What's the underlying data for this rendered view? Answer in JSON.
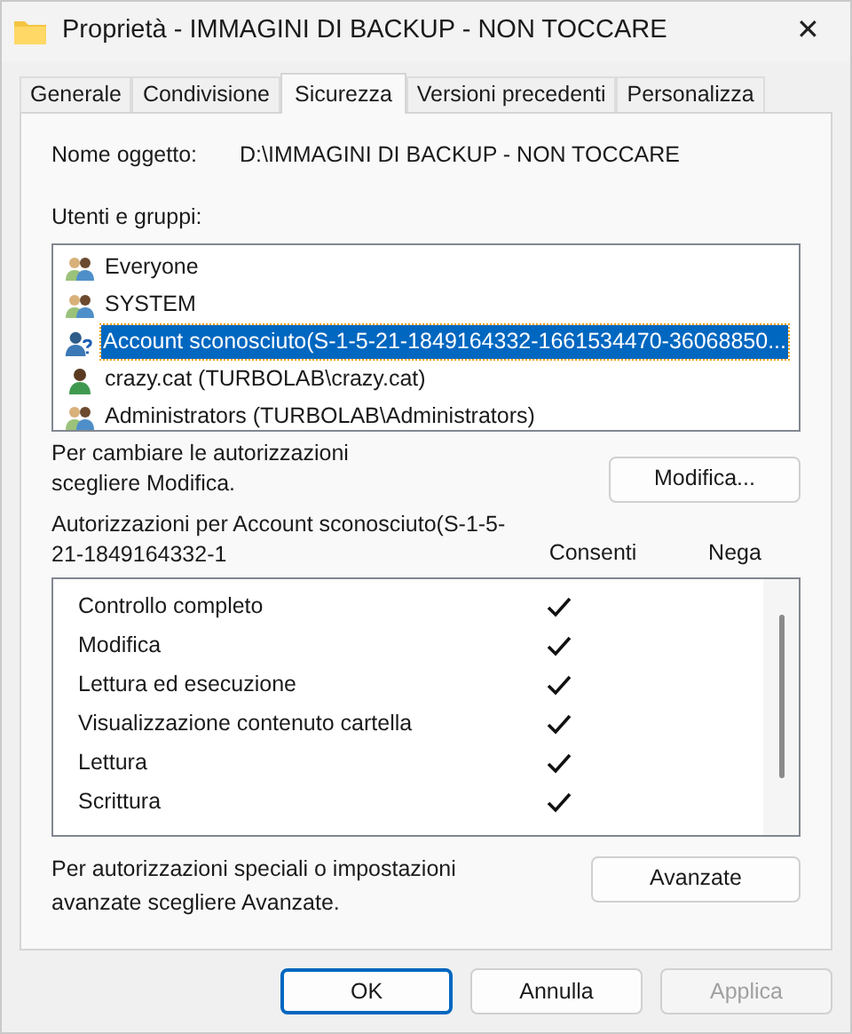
{
  "window": {
    "title": "Proprietà - IMMAGINI DI BACKUP - NON TOCCARE",
    "close": "✕"
  },
  "tabs": [
    {
      "label": "Generale",
      "selected": false
    },
    {
      "label": "Condivisione",
      "selected": false
    },
    {
      "label": "Sicurezza",
      "selected": true
    },
    {
      "label": "Versioni precedenti",
      "selected": false
    },
    {
      "label": "Personalizza",
      "selected": false
    }
  ],
  "object_name": {
    "label": "Nome oggetto:",
    "value": "D:\\IMMAGINI DI BACKUP - NON TOCCARE"
  },
  "users": {
    "label": "Utenti e gruppi:",
    "items": [
      {
        "name": "Everyone",
        "kind": "group",
        "selected": false
      },
      {
        "name": "SYSTEM",
        "kind": "group",
        "selected": false
      },
      {
        "name": "Account sconosciuto(S-1-5-21-1849164332-1661534470-36068850...",
        "kind": "unknown",
        "selected": true
      },
      {
        "name": "crazy.cat (TURBOLAB\\crazy.cat)",
        "kind": "user",
        "selected": false
      },
      {
        "name": "Administrators (TURBOLAB\\Administrators)",
        "kind": "group",
        "selected": false
      }
    ]
  },
  "change_hint": "Per cambiare le autorizzazioni scegliere Modifica.",
  "edit_button": "Modifica...",
  "permissions": {
    "title": "Autorizzazioni per Account sconosciuto(S-1-5-21-1849164332-1",
    "allow_header": "Consenti",
    "deny_header": "Nega",
    "rows": [
      {
        "label": "Controllo completo",
        "allow": true,
        "deny": false
      },
      {
        "label": "Modifica",
        "allow": true,
        "deny": false
      },
      {
        "label": "Lettura ed esecuzione",
        "allow": true,
        "deny": false
      },
      {
        "label": "Visualizzazione contenuto cartella",
        "allow": true,
        "deny": false
      },
      {
        "label": "Lettura",
        "allow": true,
        "deny": false
      },
      {
        "label": "Scrittura",
        "allow": true,
        "deny": false
      }
    ]
  },
  "advanced_hint": "Per autorizzazioni speciali o impostazioni avanzate scegliere Avanzate.",
  "advanced_button": "Avanzate",
  "buttons": [
    {
      "label": "OK",
      "kind": "default",
      "disabled": false
    },
    {
      "label": "Annulla",
      "kind": "normal",
      "disabled": false
    },
    {
      "label": "Applica",
      "kind": "normal",
      "disabled": true
    }
  ]
}
